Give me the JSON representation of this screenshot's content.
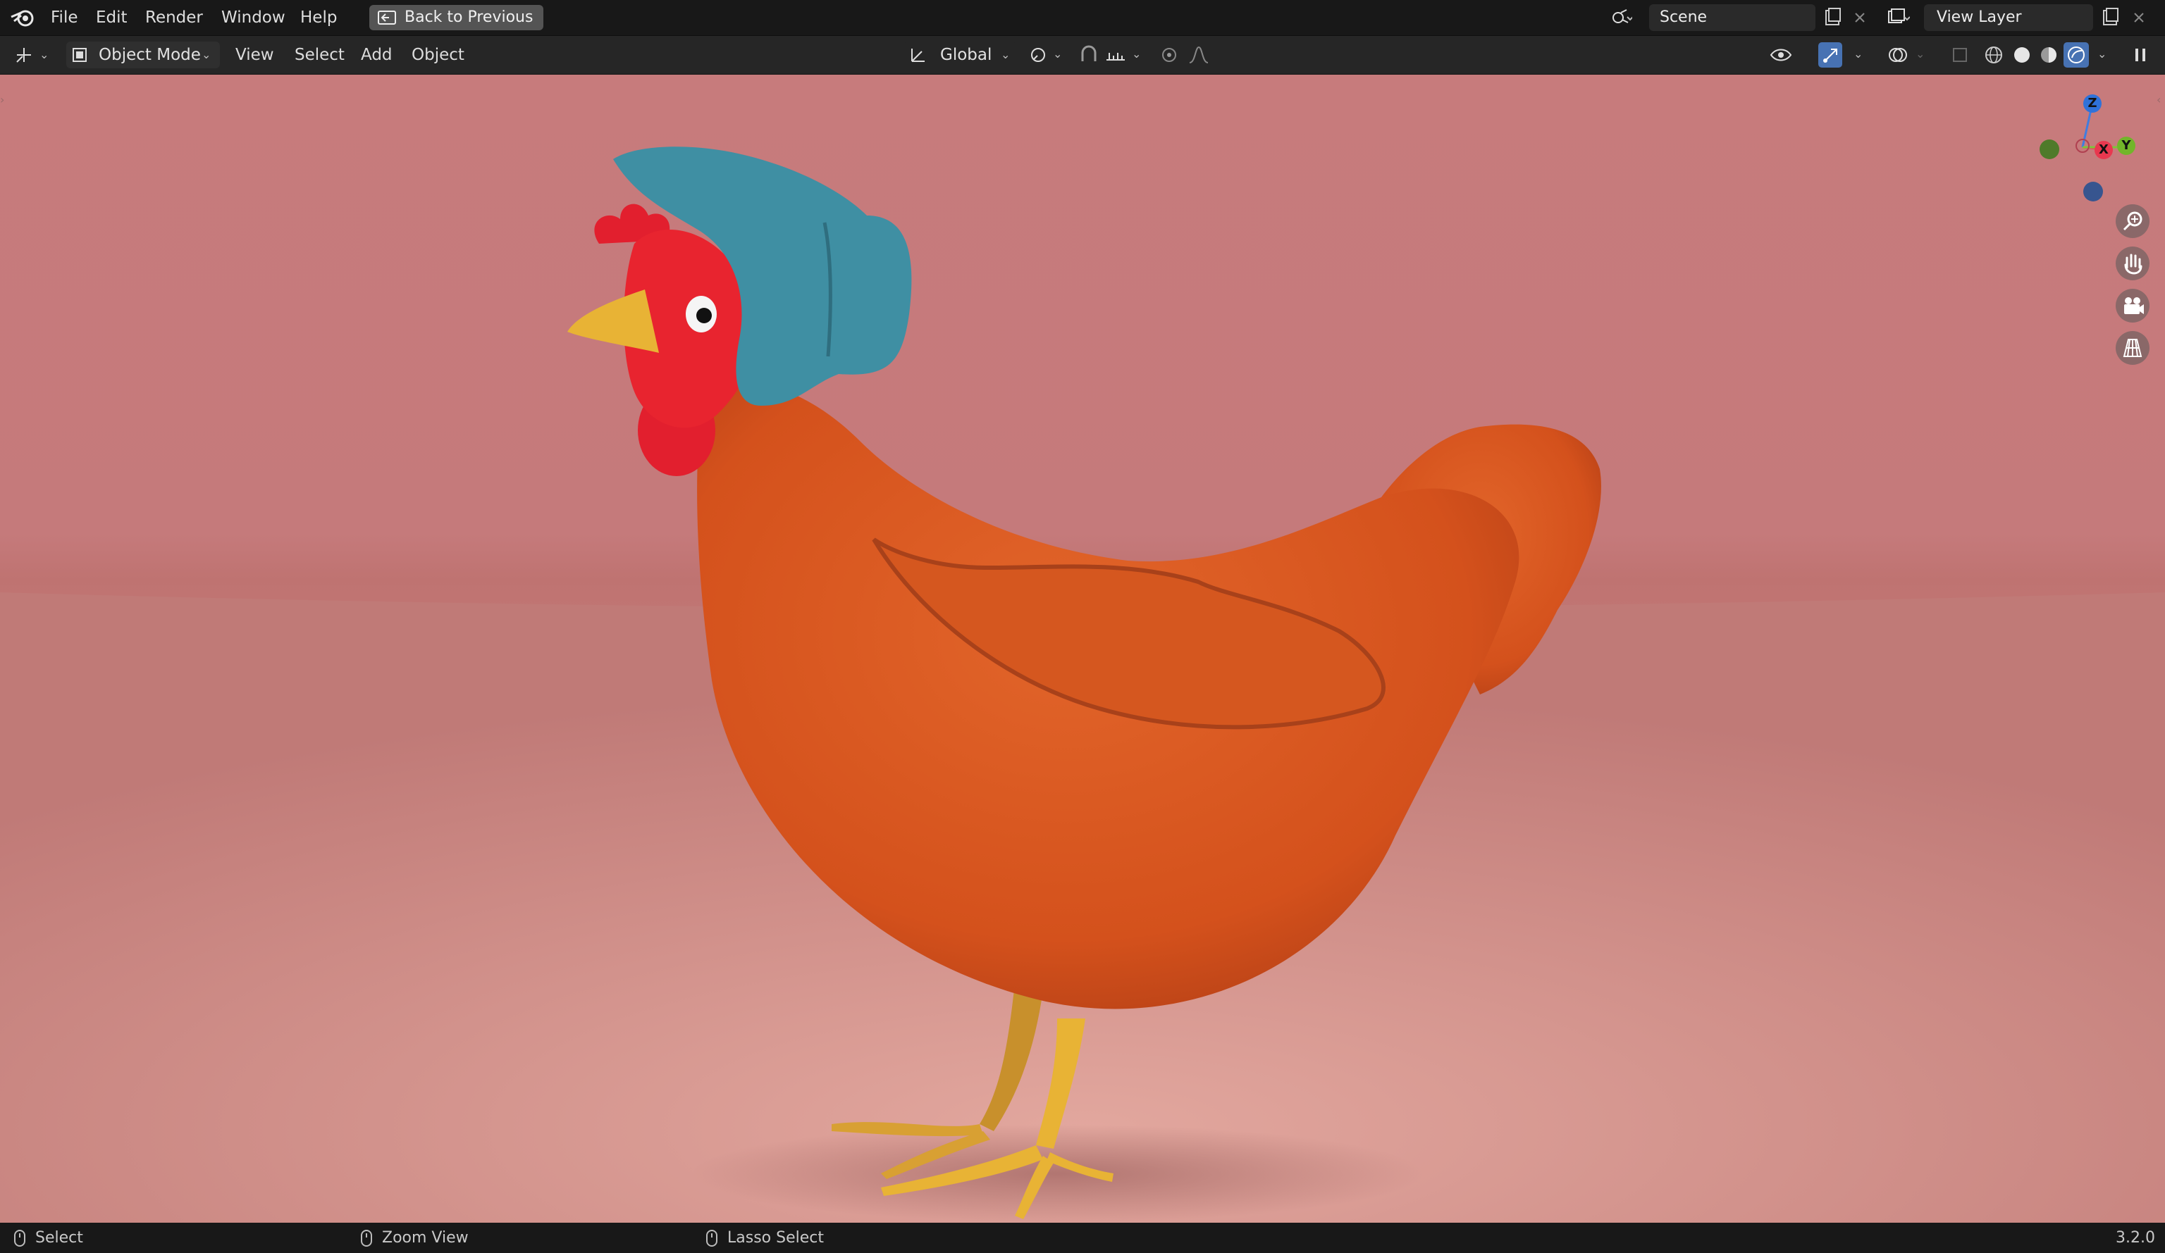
{
  "menu": {
    "file": "File",
    "edit": "Edit",
    "render": "Render",
    "window": "Window",
    "help": "Help",
    "back_to_previous": "Back to Previous"
  },
  "scene": {
    "label": "Scene"
  },
  "view_layer": {
    "label": "View Layer"
  },
  "header": {
    "mode": "Object Mode",
    "view": "View",
    "select": "Select",
    "add": "Add",
    "object": "Object",
    "transform_orientation": "Global"
  },
  "gizmo": {
    "x": "X",
    "y": "Y",
    "z": "Z"
  },
  "status": {
    "select": "Select",
    "zoom_view": "Zoom View",
    "lasso_select": "Lasso Select",
    "version": "3.2.0"
  },
  "colors": {
    "background_wall": "#c77b7c",
    "floor": "#d79a93",
    "chicken_body": "#d85a1f",
    "bonnet": "#3f8fa3",
    "comb": "#e21f2e",
    "beak_feet": "#e8b335"
  },
  "icons": [
    "blender-logo-icon",
    "back-icon",
    "scene-icon",
    "new-scene-icon",
    "close-icon",
    "view-layer-icon",
    "editor-type-icon",
    "object-mode-icon",
    "orientation-icon",
    "pivot-icon",
    "snap-icon",
    "proportional-icon",
    "visibility-icon",
    "gizmo-icon",
    "overlay-icon",
    "xray-icon",
    "wireframe-icon",
    "solid-icon",
    "material-icon",
    "rendered-icon",
    "zoom-icon",
    "pan-hand-icon",
    "camera-icon",
    "grid-icon",
    "mouse-icon"
  ]
}
